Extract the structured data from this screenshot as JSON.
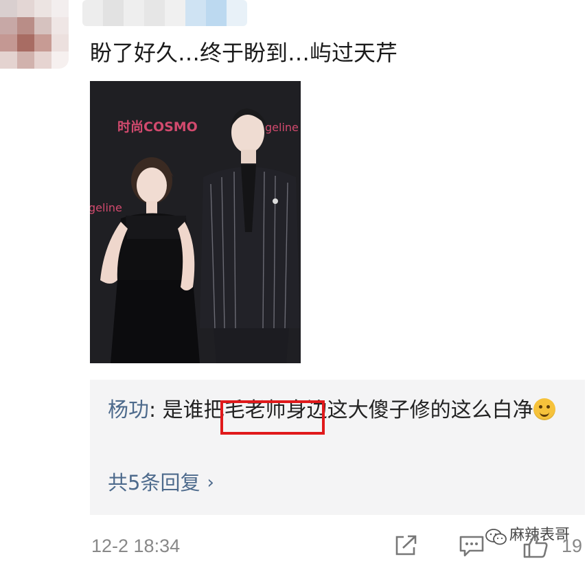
{
  "post": {
    "text": "盼了好久…终于盼到…屿过天芹",
    "photo": {
      "backdrop_brand_left": "时尚COSMO",
      "backdrop_brand_right": "geline",
      "backdrop_brand_mid": "geline"
    }
  },
  "reply": {
    "author": "杨功",
    "separator": ": ",
    "text_before_emoji": "是谁把毛老师身边这大傻子修的这么白净",
    "emoji": "upside-down-face",
    "more_label": "共5条回复",
    "highlight_color": "#e0191b"
  },
  "footer": {
    "timestamp": "12-2 18:34",
    "watermark": "麻辣表哥",
    "like_count": "19"
  },
  "colors": {
    "link": "#4d6a8c",
    "reply_bg": "#f4f4f5",
    "meta": "#888888"
  }
}
